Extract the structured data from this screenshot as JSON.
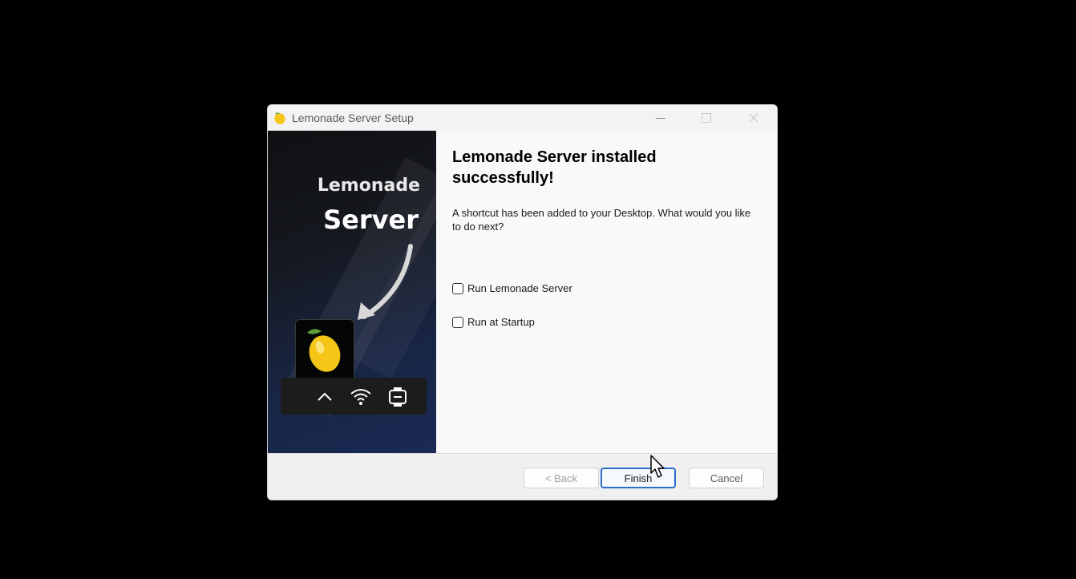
{
  "window": {
    "title": "Lemonade Server Setup",
    "controls": {
      "minimize": "—",
      "maximize": "□",
      "close": "✕"
    }
  },
  "side_panel": {
    "brand_line1": "Lemonade",
    "brand_line2": "Server",
    "popup_icon": "lemon-icon",
    "tray_icons": [
      "chevron-up-icon",
      "wifi-icon",
      "battery-icon"
    ]
  },
  "content": {
    "heading": "Lemonade Server installed successfully!",
    "description": "A shortcut has been added to your Desktop. What would you like to do next?",
    "options": [
      {
        "label": "Run Lemonade Server",
        "checked": false
      },
      {
        "label": "Run at Startup",
        "checked": false
      }
    ]
  },
  "footer": {
    "back_label": "< Back",
    "finish_label": "Finish",
    "cancel_label": "Cancel"
  },
  "colors": {
    "accent": "#2a6fc9",
    "panel_dark": "#15181f",
    "panel_blue": "#1b2a55",
    "lemon": "#f5c518"
  }
}
